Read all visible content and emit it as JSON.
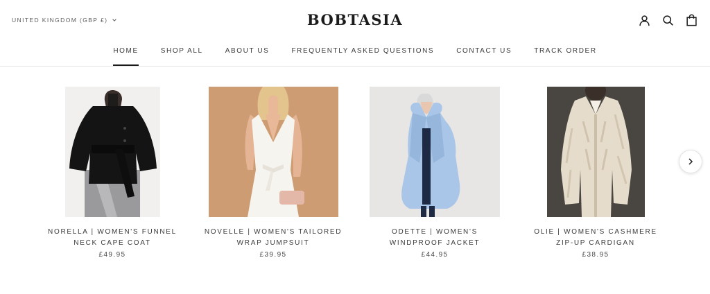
{
  "header": {
    "currency_label": "UNITED KINGDOM (GBP £)",
    "logo": "BOBTASIA",
    "icons": [
      "account-icon",
      "search-icon",
      "cart-icon"
    ]
  },
  "nav": {
    "items": [
      {
        "label": "HOME",
        "active": true
      },
      {
        "label": "SHOP ALL"
      },
      {
        "label": "ABOUT US"
      },
      {
        "label": "FREQUENTLY ASKED QUESTIONS"
      },
      {
        "label": "CONTACT US"
      },
      {
        "label": "TRACK ORDER"
      }
    ]
  },
  "products": [
    {
      "title": "NORELLA | WOMEN'S FUNNEL NECK CAPE COAT",
      "price": "£49.95"
    },
    {
      "title": "NOVELLE | WOMEN'S TAILORED WRAP JUMPSUIT",
      "price": "£39.95"
    },
    {
      "title": "ODETTE | WOMEN'S WINDPROOF JACKET",
      "price": "£44.95"
    },
    {
      "title": "OLIE | WOMEN'S CASHMERE ZIP-UP CARDIGAN",
      "price": "£38.95"
    }
  ],
  "carousel": {
    "next_icon": "chevron-right-icon"
  },
  "colors": {
    "text": "#1c1b1b",
    "divider": "#e6e6e6",
    "background": "#ffffff"
  }
}
